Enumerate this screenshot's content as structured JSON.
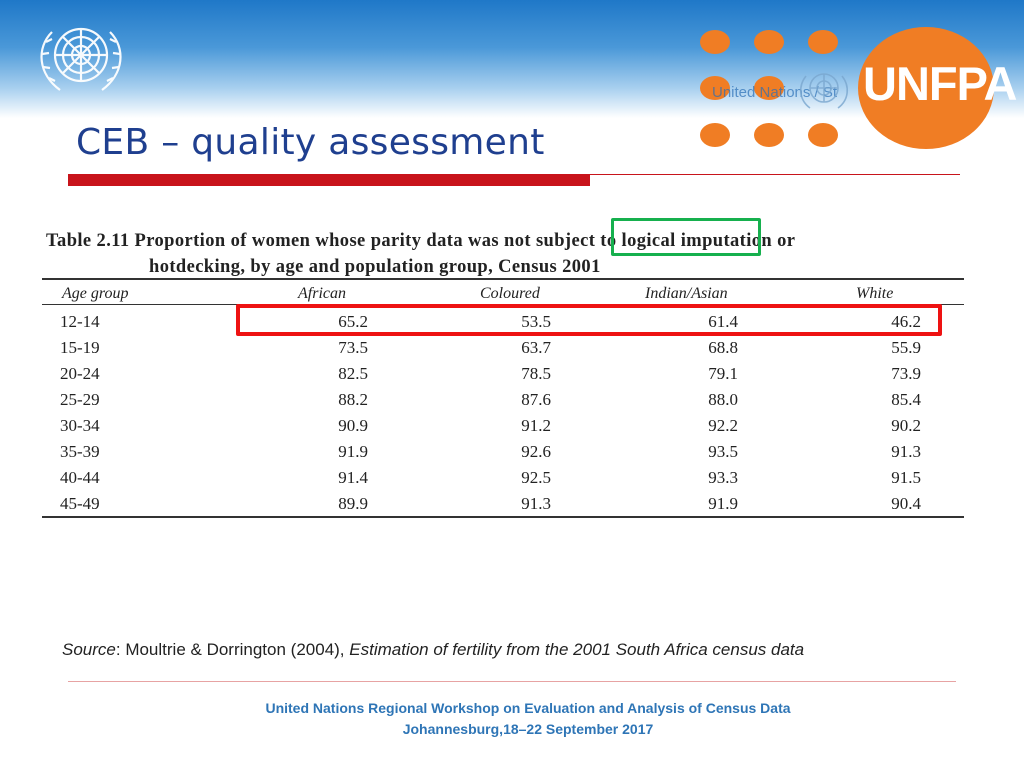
{
  "slide": {
    "title": "CEB – quality assessment"
  },
  "logos": {
    "un_emblem": "un-emblem-icon",
    "unfpa_text": "UNFPA",
    "unfpa_faded_text": "United Nations / St",
    "unfpa_color": "#f07d24"
  },
  "table": {
    "caption_line1": "Table 2.11 Proportion of women whose parity data was not subject to logical imputation or",
    "caption_line2": "hotdecking, by age and population group, Census 2001",
    "headers": [
      "Age group",
      "African",
      "Coloured",
      "Indian/Asian",
      "White"
    ],
    "rows": [
      [
        "12-14",
        "65.2",
        "53.5",
        "61.4",
        "46.2"
      ],
      [
        "15-19",
        "73.5",
        "63.7",
        "68.8",
        "55.9"
      ],
      [
        "20-24",
        "82.5",
        "78.5",
        "79.1",
        "73.9"
      ],
      [
        "25-29",
        "88.2",
        "87.6",
        "88.0",
        "85.4"
      ],
      [
        "30-34",
        "90.9",
        "91.2",
        "92.2",
        "90.2"
      ],
      [
        "35-39",
        "91.9",
        "92.6",
        "93.5",
        "91.3"
      ],
      [
        "40-44",
        "91.4",
        "92.5",
        "93.3",
        "91.5"
      ],
      [
        "45-49",
        "89.9",
        "91.3",
        "91.9",
        "90.4"
      ]
    ],
    "highlight_colors": {
      "phrase_box": "#16b04e",
      "row_box": "#ee1212"
    }
  },
  "source": {
    "label": "Source",
    "authors": ": Moultrie & Dorrington (2004), ",
    "title": "Estimation of fertility from the 2001 South Africa census data"
  },
  "footer": {
    "line1": "United Nations Regional Workshop on Evaluation and Analysis of Census Data",
    "line2": "Johannesburg,18–22 September 2017"
  }
}
